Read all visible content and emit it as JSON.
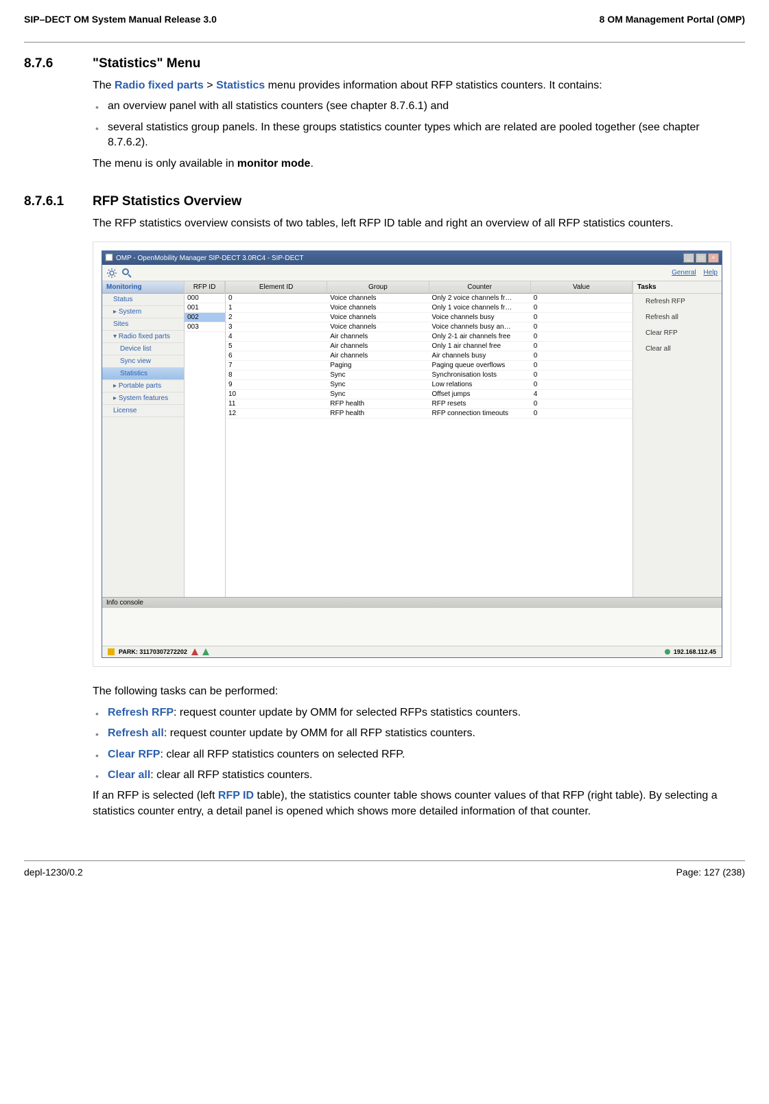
{
  "header": {
    "left": "SIP–DECT OM System Manual Release 3.0",
    "right": "8 OM Management Portal (OMP)"
  },
  "s1": {
    "num": "8.7.6",
    "title": "\"Statistics\" Menu",
    "intro_pre": "The ",
    "intro_link1": "Radio fixed parts",
    "intro_gt": " > ",
    "intro_link2": "Statistics",
    "intro_post": " menu provides information about RFP statistics counters. It contains:",
    "bullet1": "an overview panel with all statistics counters (see chapter 8.7.6.1) and",
    "bullet2": "several statistics group panels. In these groups statistics counter types which are related are pooled together (see chapter 8.7.6.2).",
    "note": "The menu is only available in ",
    "note_b": "monitor mode",
    "note_end": "."
  },
  "s2": {
    "num": "8.7.6.1",
    "title": "RFP Statistics Overview",
    "para": "The RFP statistics overview consists of two tables, left RFP ID table and right an overview of all RFP statistics counters."
  },
  "app": {
    "title": "OMP - OpenMobility Manager SIP-DECT 3.0RC4 - SIP-DECT",
    "toolbar_links": {
      "general": "General",
      "help": "Help"
    },
    "sidebar": {
      "header": "Monitoring",
      "items": [
        {
          "label": "Status",
          "sub": false
        },
        {
          "label": "System",
          "sub": false,
          "exp": true
        },
        {
          "label": "Sites",
          "sub": false
        },
        {
          "label": "Radio fixed parts",
          "sub": false,
          "expanded": true
        },
        {
          "label": "Device list",
          "sub": true
        },
        {
          "label": "Sync view",
          "sub": true
        },
        {
          "label": "Statistics",
          "sub": true,
          "active": true
        },
        {
          "label": "Portable parts",
          "sub": false,
          "exp": true
        },
        {
          "label": "System features",
          "sub": false,
          "exp": true
        },
        {
          "label": "License",
          "sub": false
        }
      ]
    },
    "rfp_header": "RFP ID",
    "rfp_ids": [
      "000",
      "001",
      "002",
      "003"
    ],
    "rfp_selected_index": 2,
    "data_headers": [
      "Element ID",
      "Group",
      "Counter",
      "Value"
    ],
    "data_rows": [
      [
        "0",
        "Voice channels",
        "Only 2 voice channels fr…",
        "0"
      ],
      [
        "1",
        "Voice channels",
        "Only 1 voice channels fr…",
        "0"
      ],
      [
        "2",
        "Voice channels",
        "Voice channels busy",
        "0"
      ],
      [
        "3",
        "Voice channels",
        "Voice channels busy an…",
        "0"
      ],
      [
        "4",
        "Air channels",
        "Only 2-1 air channels free",
        "0"
      ],
      [
        "5",
        "Air channels",
        "Only 1 air channel free",
        "0"
      ],
      [
        "6",
        "Air channels",
        "Air channels busy",
        "0"
      ],
      [
        "7",
        "Paging",
        "Paging queue overflows",
        "0"
      ],
      [
        "8",
        "Sync",
        "Synchronisation losts",
        "0"
      ],
      [
        "9",
        "Sync",
        "Low relations",
        "0"
      ],
      [
        "10",
        "Sync",
        "Offset jumps",
        "4"
      ],
      [
        "11",
        "RFP health",
        "RFP resets",
        "0"
      ],
      [
        "12",
        "RFP health",
        "RFP connection timeouts",
        "0"
      ]
    ],
    "tasks_header": "Tasks",
    "tasks": [
      "Refresh RFP",
      "Refresh all",
      "Clear RFP",
      "Clear all"
    ],
    "info_label": "Info console",
    "status_left": "PARK: 31170307272202",
    "status_right": "192.168.112.45"
  },
  "after": {
    "intro": "The following tasks can be performed:",
    "t1_l": "Refresh RFP",
    "t1_t": ": request counter update by OMM for selected RFPs statistics counters.",
    "t2_l": "Refresh all",
    "t2_t": ": request counter update by OMM for all RFP statistics counters.",
    "t3_l": "Clear RFP",
    "t3_t": ": clear all RFP statistics counters on selected RFP.",
    "t4_l": "Clear all",
    "t4_t": ": clear all RFP statistics counters.",
    "closing_a": "If an RFP is selected (left ",
    "closing_link": "RFP ID",
    "closing_b": " table), the statistics counter table shows counter values of that RFP (right table). By selecting a statistics counter entry, a detail panel is opened which shows more detailed information of that counter."
  },
  "footer": {
    "left": "depl-1230/0.2",
    "right": "Page: 127 (238)"
  }
}
